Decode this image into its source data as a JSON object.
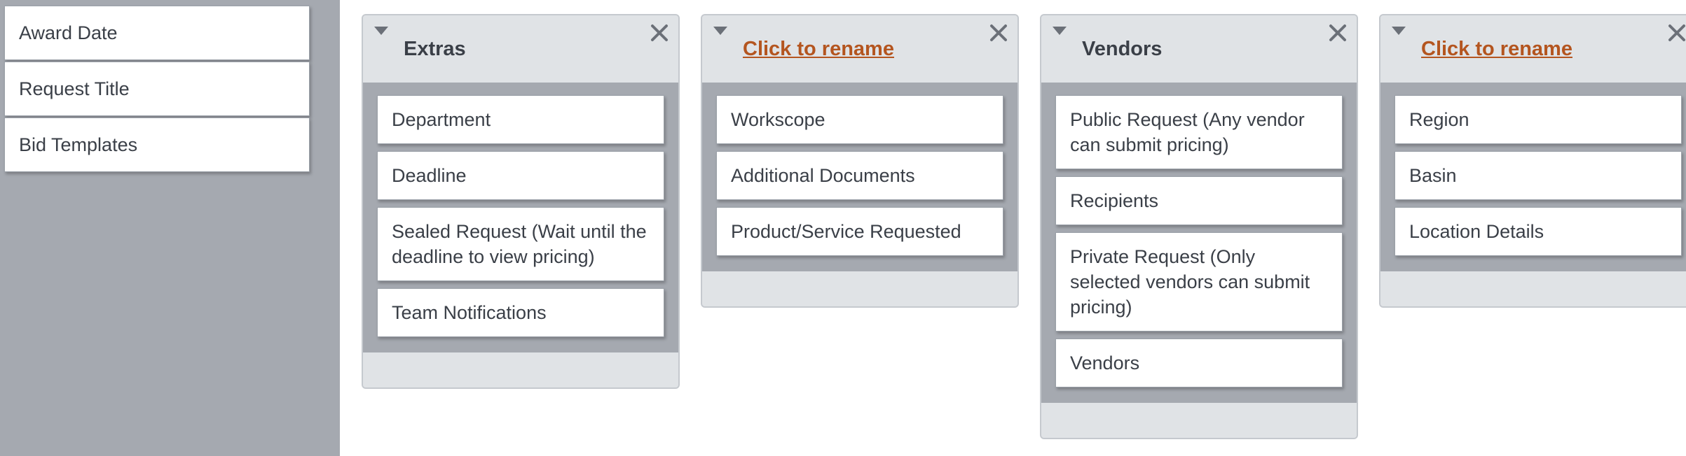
{
  "available_fields": [
    {
      "label": "Award Date"
    },
    {
      "label": "Request Title"
    },
    {
      "label": "Bid Templates"
    }
  ],
  "groups": [
    {
      "title": "Extras",
      "title_is_rename_link": false,
      "fields": [
        {
          "label": "Department"
        },
        {
          "label": "Deadline"
        },
        {
          "label": "Sealed Request (Wait until the deadline to view pricing)"
        },
        {
          "label": "Team Notifications"
        }
      ]
    },
    {
      "title": "Click to rename",
      "title_is_rename_link": true,
      "fields": [
        {
          "label": "Workscope"
        },
        {
          "label": "Additional Documents"
        },
        {
          "label": "Product/Service Requested"
        }
      ]
    },
    {
      "title": "Vendors",
      "title_is_rename_link": false,
      "fields": [
        {
          "label": "Public Request (Any vendor can submit pricing)"
        },
        {
          "label": "Recipients"
        },
        {
          "label": "Private Request (Only selected vendors can submit pricing)"
        },
        {
          "label": "Vendors"
        }
      ]
    },
    {
      "title": "Click to rename",
      "title_is_rename_link": true,
      "fields": [
        {
          "label": "Region"
        },
        {
          "label": "Basin"
        },
        {
          "label": "Location Details"
        }
      ]
    }
  ],
  "icons": {
    "collapse": "triangle-down-icon",
    "close": "close-x-icon"
  },
  "colors": {
    "sidebar_bg": "#a5a9b0",
    "group_bg": "#e0e3e6",
    "rename_link": "#b4551f",
    "text": "#3a3f47"
  }
}
